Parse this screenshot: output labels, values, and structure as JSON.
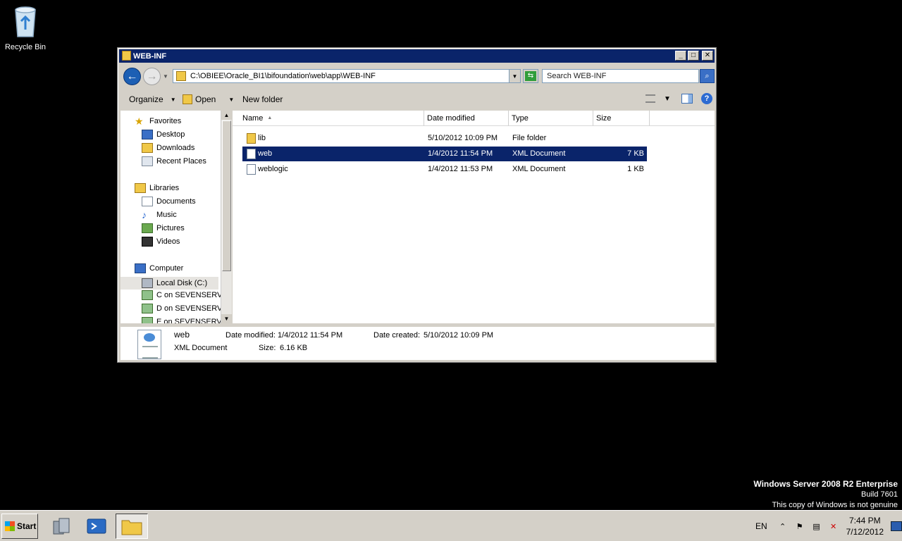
{
  "desktop": {
    "recycle_bin_label": "Recycle Bin",
    "watermark": {
      "line1": "Windows Server 2008 R2 Enterprise",
      "line2": "Build 7601",
      "line3": "This copy of Windows is not genuine"
    }
  },
  "window": {
    "title": "WEB-INF",
    "controls": [
      "minimize",
      "maximize",
      "close"
    ]
  },
  "address": {
    "path": "C:\\OBIEE\\Oracle_BI1\\bifoundation\\web\\app\\WEB-INF",
    "search_placeholder": "Search WEB-INF"
  },
  "toolbar": {
    "organize": "Organize",
    "open": "Open",
    "new_folder": "New folder"
  },
  "nav": {
    "favorites": "Favorites",
    "desktop": "Desktop",
    "downloads": "Downloads",
    "recent_places": "Recent Places",
    "libraries": "Libraries",
    "documents": "Documents",
    "music": "Music",
    "pictures": "Pictures",
    "videos": "Videos",
    "computer": "Computer",
    "local_disk": "Local Disk (C:)",
    "c_on": "C on SEVENSERVER",
    "d_on": "D on SEVENSERVER",
    "e_on": "E on SEVENSERVER"
  },
  "columns": {
    "name": "Name",
    "date_modified": "Date modified",
    "type": "Type",
    "size": "Size"
  },
  "files": [
    {
      "name": "lib",
      "date": "5/10/2012 10:09 PM",
      "type": "File folder",
      "size": ""
    },
    {
      "name": "web",
      "date": "1/4/2012 11:54 PM",
      "type": "XML Document",
      "size": "7 KB"
    },
    {
      "name": "weblogic",
      "date": "1/4/2012 11:53 PM",
      "type": "XML Document",
      "size": "1 KB"
    }
  ],
  "details": {
    "name": "web",
    "type": "XML Document",
    "date_modified_label": "Date modified:",
    "date_modified": "1/4/2012 11:54 PM",
    "date_created_label": "Date created:",
    "date_created": "5/10/2012 10:09 PM",
    "size_label": "Size:",
    "size": "6.16 KB"
  },
  "taskbar": {
    "start": "Start",
    "lang": "EN",
    "time": "7:44 PM",
    "date": "7/12/2012"
  }
}
